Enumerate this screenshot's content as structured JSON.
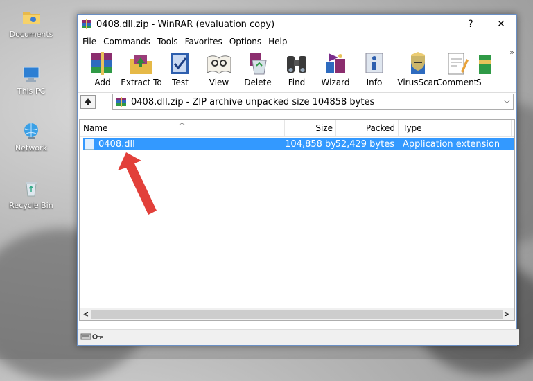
{
  "desktop": {
    "icons": [
      {
        "label": "Documents",
        "icon": "documents-folder-icon"
      },
      {
        "label": "This PC",
        "icon": "computer-icon"
      },
      {
        "label": "Network",
        "icon": "network-globe-icon"
      },
      {
        "label": "Recycle Bin",
        "icon": "recycle-bin-icon"
      }
    ]
  },
  "window": {
    "title": "0408.dll.zip - WinRAR (evaluation copy)",
    "help_glyph": "?",
    "close_glyph": "✕"
  },
  "menu": [
    "File",
    "Commands",
    "Tools",
    "Favorites",
    "Options",
    "Help"
  ],
  "toolbar": {
    "buttons": [
      {
        "label": "Add",
        "icon": "books-stack-icon"
      },
      {
        "label": "Extract To",
        "icon": "folder-extract-icon"
      },
      {
        "label": "Test",
        "icon": "test-checkmark-icon"
      },
      {
        "label": "View",
        "icon": "open-book-glasses-icon"
      },
      {
        "label": "Delete",
        "icon": "delete-recycle-icon"
      },
      {
        "label": "Find",
        "icon": "binoculars-icon"
      },
      {
        "label": "Wizard",
        "icon": "wizard-icon"
      },
      {
        "label": "Info",
        "icon": "info-icon"
      },
      {
        "label": "VirusScan",
        "icon": "virus-scan-icon"
      },
      {
        "label": "Comment",
        "icon": "comment-pen-icon"
      },
      {
        "label": "S",
        "icon": "sfx-icon"
      }
    ],
    "overflow": "»"
  },
  "address": {
    "text": "0408.dll.zip - ZIP archive unpacked size 104858 bytes",
    "dropdown": "⌵"
  },
  "list": {
    "columns": [
      "Name",
      "Size",
      "Packed",
      "Type"
    ],
    "rows": [
      {
        "name": "0408.dll",
        "size": "104,858 by",
        "packed": "52,429 bytes",
        "type": "Application extension"
      }
    ],
    "selection_color": "#3399ff"
  },
  "scroll": {
    "left": "<",
    "right": ">"
  },
  "annotation": {
    "arrow_color": "#e2403a"
  }
}
